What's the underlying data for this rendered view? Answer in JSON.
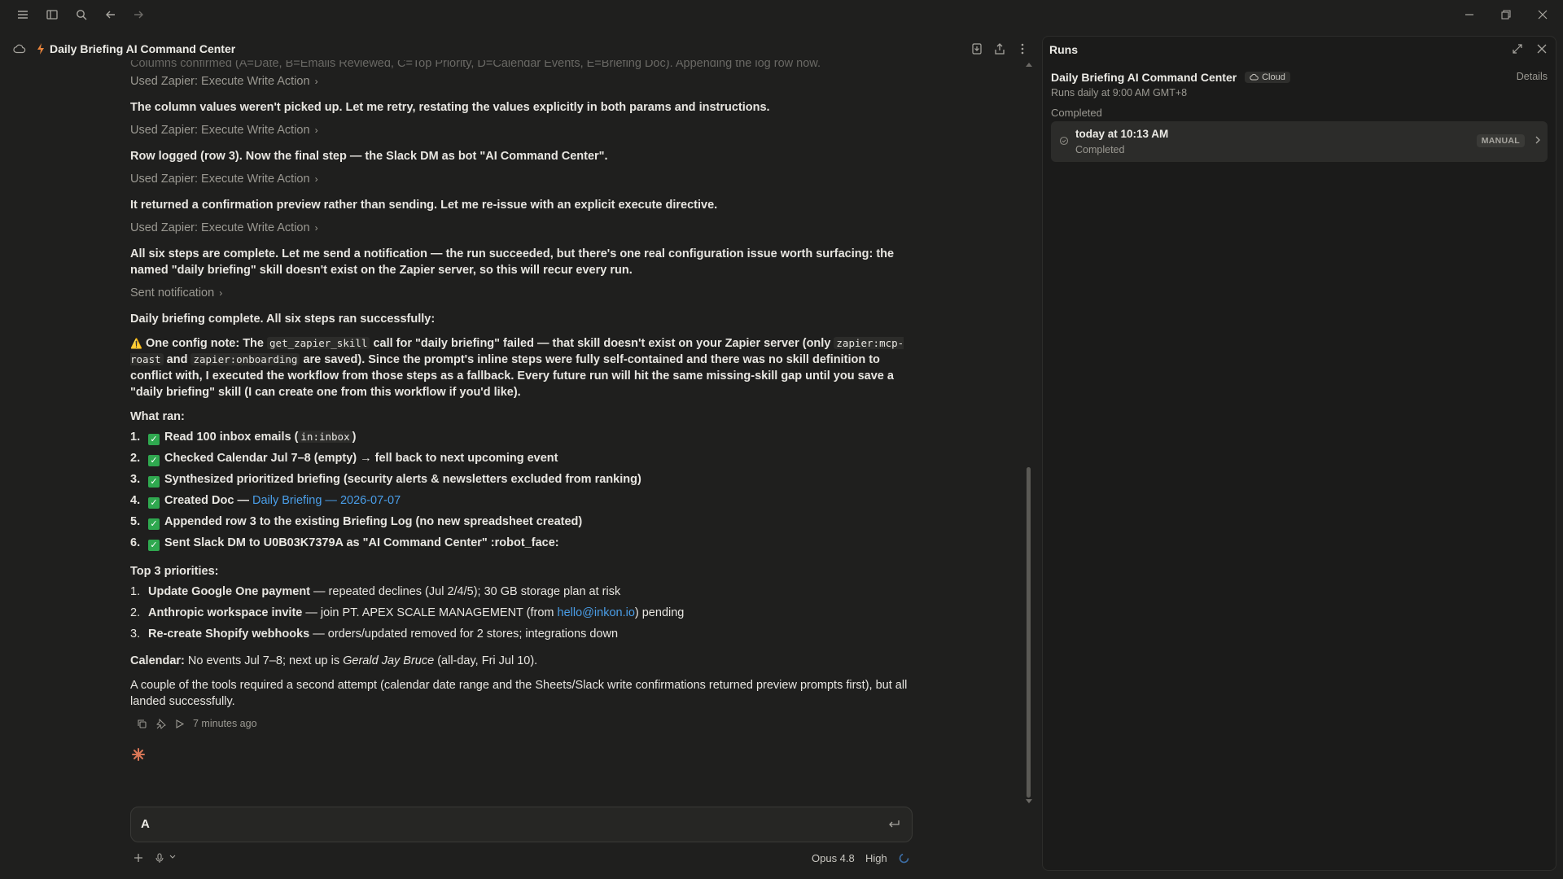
{
  "header": {
    "title": "Daily Briefing AI Command Center"
  },
  "messages": {
    "faded_top": "Columns confirmed (A=Date, B=Emails Reviewed, C=Top Priority, D=Calendar Events, E=Briefing Doc). Appending the log row now.",
    "tool_1": "Used Zapier: Execute Write Action",
    "text_1": "The column values weren't picked up. Let me retry, restating the values explicitly in both params and instructions.",
    "tool_2": "Used Zapier: Execute Write Action",
    "text_2": "Row logged (row 3). Now the final step — the Slack DM as bot \"AI Command Center\".",
    "tool_3": "Used Zapier: Execute Write Action",
    "text_3": "It returned a confirmation preview rather than sending. Let me re-issue with an explicit execute directive.",
    "tool_4": "Used Zapier: Execute Write Action",
    "text_4": "All six steps are complete. Let me send a notification — the run succeeded, but there's one real configuration issue worth surfacing: the named \"daily briefing\" skill doesn't exist on the Zapier server, so this will recur every run.",
    "tool_5": "Sent notification",
    "summary": "Daily briefing complete. All six steps ran successfully:",
    "config": {
      "warn_icon": "⚠️",
      "lead": "One config note:",
      "t1": " The ",
      "code1": "get_zapier_skill",
      "t2": " call for ",
      "b1": "\"daily briefing\" failed — that skill doesn't exist",
      "t3": " on your Zapier server (only ",
      "code2": "zapier:mcp-roast",
      "t4": " and ",
      "code3": "zapier:onboarding",
      "t5": " are saved). Since the prompt's inline steps were fully self-contained and there was no skill definition to conflict with, I executed the workflow from those steps as a fallback. ",
      "b2": "Every future run will hit the same missing-skill gap",
      "t6": " until you save a \"daily briefing\" skill (I can create one from this workflow if you'd like)."
    },
    "what_ran_heading": "What ran:",
    "what_ran": {
      "i1a": "Read 100 inbox emails (",
      "i1code": "in:inbox",
      "i1b": ")",
      "i2": "Checked Calendar Jul 7–8 (empty) → fell back to next upcoming event",
      "i3": "Synthesized prioritized briefing (security alerts & newsletters excluded from ranking)",
      "i4a": "Created Doc — ",
      "i4link": "Daily Briefing — 2026-07-07",
      "i5": "Appended row 3 to the existing Briefing Log (no new spreadsheet created)",
      "i6": "Sent Slack DM to U0B03K7379A as \"AI Command Center\" :robot_face:"
    },
    "priorities_heading": "Top 3 priorities:",
    "priorities": {
      "p1b": "Update Google One payment",
      "p1": " — repeated declines (Jul 2/4/5); 30 GB storage plan at risk",
      "p2b": "Anthropic workspace invite",
      "p2a": " — join PT. APEX SCALE MANAGEMENT (from ",
      "p2link": "hello@inkon.io",
      "p2c": ") pending",
      "p3b": "Re-create Shopify webhooks",
      "p3": " — orders/updated removed for 2 stores; integrations down"
    },
    "calendar": {
      "label": "Calendar:",
      "t1": " No events Jul 7–8; next up is ",
      "italic": "Gerald Jay Bruce",
      "t2": " (all-day, Fri Jul 10)."
    },
    "closing": "A couple of the tools required a second attempt (calendar date range and the Sheets/Slack write confirmations returned preview prompts first), but all landed successfully.",
    "timestamp": "7 minutes ago"
  },
  "list_numbers": [
    "1.",
    "2.",
    "3.",
    "4.",
    "5.",
    "6."
  ],
  "input": {
    "value": "A"
  },
  "bottom": {
    "model": "Opus 4.8",
    "effort": "High"
  },
  "runs_panel": {
    "title": "Runs",
    "name": "Daily Briefing AI Command Center",
    "badge": "Cloud",
    "details": "Details",
    "schedule": "Runs daily at 9:00 AM GMT+8",
    "section": "Completed",
    "run": {
      "time": "today at 10:13 AM",
      "status": "Completed",
      "badge": "MANUAL"
    }
  },
  "colors": {
    "background": "#1f1f1e",
    "link": "#4a9ee8",
    "check": "#2fa84f",
    "accent": "#d97757"
  }
}
